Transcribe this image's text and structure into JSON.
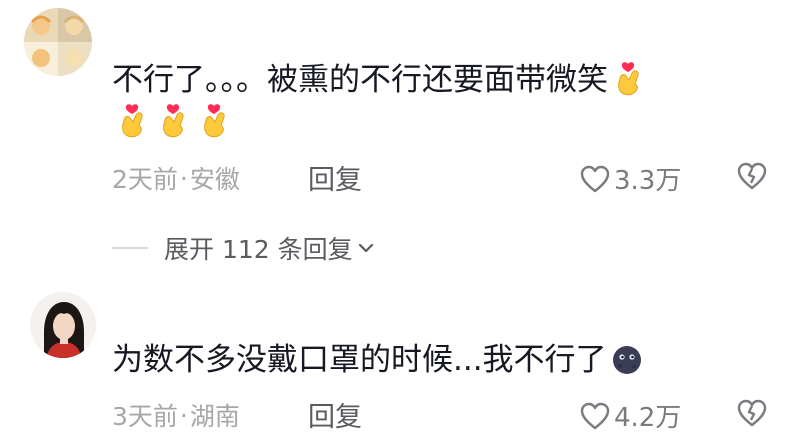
{
  "comments": [
    {
      "username": "",
      "text_line1": "不行了。。。被熏的不行还要面带微笑",
      "emojis_inline": [
        "finger-heart-icon"
      ],
      "emojis_row": [
        "finger-heart-icon",
        "finger-heart-icon",
        "finger-heart-icon"
      ],
      "time": "2天前",
      "dot": "·",
      "location": "安徽",
      "reply_label": "回复",
      "likes": "3.3万",
      "replies_expand": "展开 112 条回复"
    },
    {
      "text_line1": "为数不多没戴口罩的时候...我不行了",
      "emojis_inline": [
        "new-moon-face-icon"
      ],
      "time": "3天前",
      "dot": "·",
      "location": "湖南",
      "reply_label": "回复",
      "likes": "4.2万"
    }
  ],
  "colors": {
    "text": "#161823",
    "meta": "#a7a7ab",
    "reply": "#5a5a60",
    "heart": "#ff2d55",
    "emoji_yellow": "#ffc93c"
  }
}
